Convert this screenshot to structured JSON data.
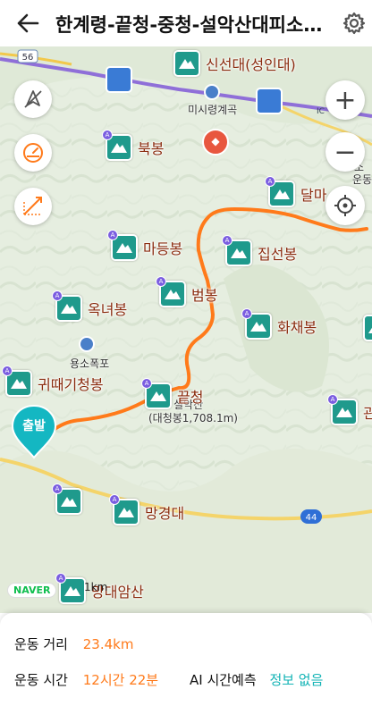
{
  "header": {
    "title": "한계령-끝청-중청-설악산대피소-오색",
    "back_icon": "arrow-left-icon",
    "settings_icon": "gear-icon"
  },
  "map": {
    "peaks": [
      {
        "label": "신선대(성인대)"
      },
      {
        "label": "북봉"
      },
      {
        "label": "달마"
      },
      {
        "label": "마등봉"
      },
      {
        "label": "집선봉"
      },
      {
        "label": "범봉"
      },
      {
        "label": "옥녀봉"
      },
      {
        "label": "화채봉"
      },
      {
        "label": "귀때기청봉"
      },
      {
        "label": "끝청"
      },
      {
        "label": "관"
      },
      {
        "label": "망경대"
      },
      {
        "label": "망대암산"
      }
    ],
    "labels": {
      "valley": "미시령계곡",
      "falls": "용소폭포",
      "mountain": "설악산",
      "mountain_sub": "(대청봉1,708.1m)",
      "road_56": "56",
      "road_44": "44",
      "road_edge": "IC",
      "edge_top": "소",
      "edge_bottom": "운동"
    },
    "start_label": "출발",
    "naver": "NAVER",
    "scale": "1km",
    "zoom_in": "+",
    "zoom_out": "−",
    "route_color": "#ff7a1a"
  },
  "info": {
    "distance_label": "운동 거리",
    "distance_value": "23.4km",
    "time_label": "운동 시간",
    "time_value": "12시간 22분",
    "ai_label": "AI 시간예측",
    "ai_value": "정보 없음"
  }
}
